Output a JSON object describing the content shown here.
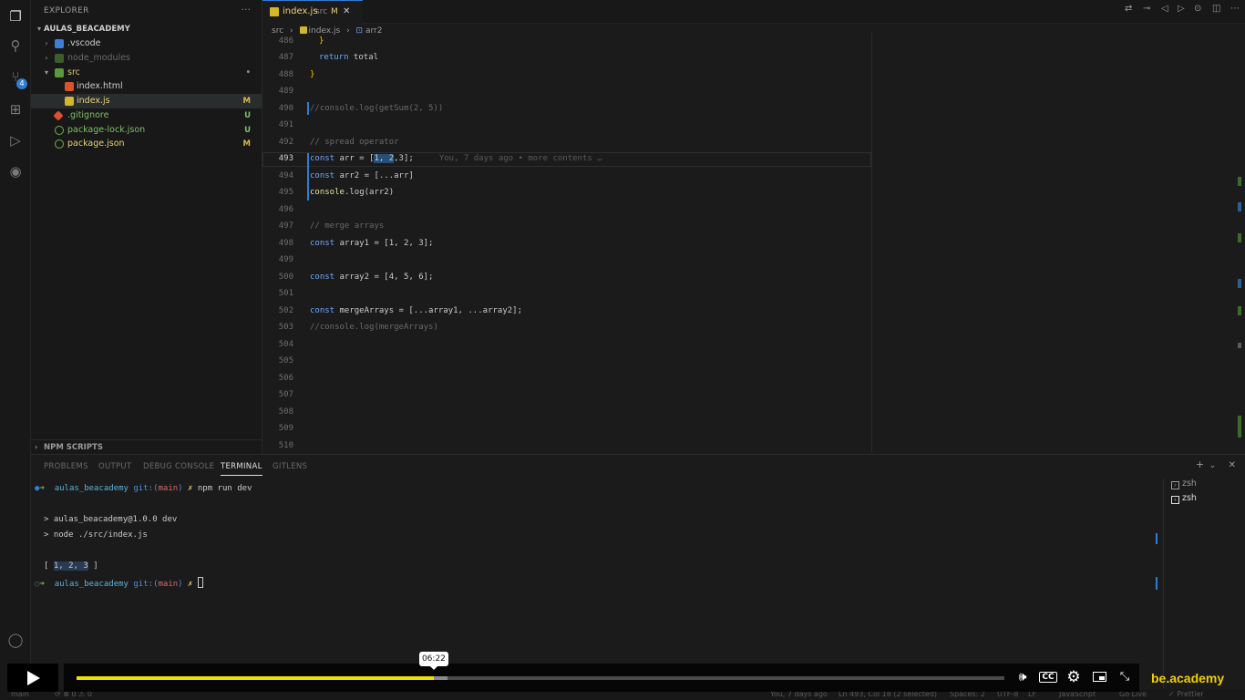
{
  "explorer": {
    "title": "EXPLORER",
    "more": "···",
    "root": "AULAS_BEACADEMY",
    "items": [
      {
        "name": ".vscode",
        "kind": "folder",
        "status": ""
      },
      {
        "name": "node_modules",
        "kind": "folder",
        "status": ""
      },
      {
        "name": "src",
        "kind": "folder-open",
        "status": "•"
      },
      {
        "name": "index.html",
        "kind": "html",
        "status": ""
      },
      {
        "name": "index.js",
        "kind": "js",
        "status": "M"
      },
      {
        "name": ".gitignore",
        "kind": "git",
        "status": "U"
      },
      {
        "name": "package-lock.json",
        "kind": "json",
        "status": "U"
      },
      {
        "name": "package.json",
        "kind": "json",
        "status": "M"
      }
    ],
    "npm_scripts": "NPM SCRIPTS",
    "source_control_badge": "4"
  },
  "editor": {
    "tab": {
      "name": "index.js",
      "dir": "src",
      "modified": "M",
      "close": "✕"
    },
    "breadcrumb": {
      "part1": "src",
      "sep": "›",
      "part2": "index.js",
      "part3": "arr2"
    },
    "line_numbers": [
      "486",
      "487",
      "488",
      "489",
      "490",
      "491",
      "492",
      "493",
      "494",
      "495",
      "496",
      "497",
      "498",
      "499",
      "500",
      "501",
      "502",
      "503",
      "504",
      "505",
      "506",
      "507",
      "508",
      "509",
      "510"
    ],
    "current_line": "493",
    "code": {
      "l486": "}",
      "l487_kw": "return",
      "l487_rest": " total",
      "l488": "}",
      "l490": "//console.log(getSum(2, 5))",
      "l492": "// spread operator",
      "l493_kw": "const",
      "l493_a": " arr = [",
      "l493_sel": "1, 2",
      "l493_b": ",3];",
      "l493_blame": "You, 7 days ago • more contents …",
      "l494_kw": "const",
      "l494_rest": " arr2 = [...arr]",
      "l495_fn": "console",
      "l495_rest": ".log(arr2)",
      "l497": "// merge arrays",
      "l498_kw": "const",
      "l498_rest": " array1 = [1, 2, 3];",
      "l500_kw": "const",
      "l500_rest": " array2 = [4, 5, 6];",
      "l502_kw": "const",
      "l502_rest": " mergeArrays = [...array1, ...array2];",
      "l503": "//console.log(mergeArrays)"
    }
  },
  "panel": {
    "tabs": [
      "PROBLEMS",
      "OUTPUT",
      "DEBUG CONSOLE",
      "TERMINAL",
      "GITLENS"
    ],
    "active_tab": "TERMINAL",
    "actions": {
      "add": "+",
      "split": "⌄",
      "close": "✕"
    },
    "terminal": {
      "prompt_dir": "aulas_beacademy",
      "git_label": "git:(",
      "branch": "main",
      "git_close": ")",
      "x": "✗",
      "command": "npm run dev",
      "out1": "> aulas_beacademy@1.0.0 dev",
      "out2": "> node ./src/index.js",
      "out3_open": "[ ",
      "out3_vals": "1, 2, 3",
      "out3_close": " ]"
    },
    "terminals": [
      "zsh",
      "zsh"
    ]
  },
  "status_bar": {
    "branch": "main",
    "sync": "⟳  ⊗ 0 ⚠ 0",
    "blame": "You, 7 days ago",
    "position": "Ln 493, Col 18 (2 selected)",
    "spaces": "Spaces: 2",
    "encoding": "UTF-8",
    "eol": "LF",
    "language": "JavaScript",
    "golive": "Go Live",
    "prettier": "✓ Prettier"
  },
  "player": {
    "time_tooltip": "06:22",
    "progress": 0.385,
    "buffered": 0.4,
    "brand": "be.academy"
  }
}
